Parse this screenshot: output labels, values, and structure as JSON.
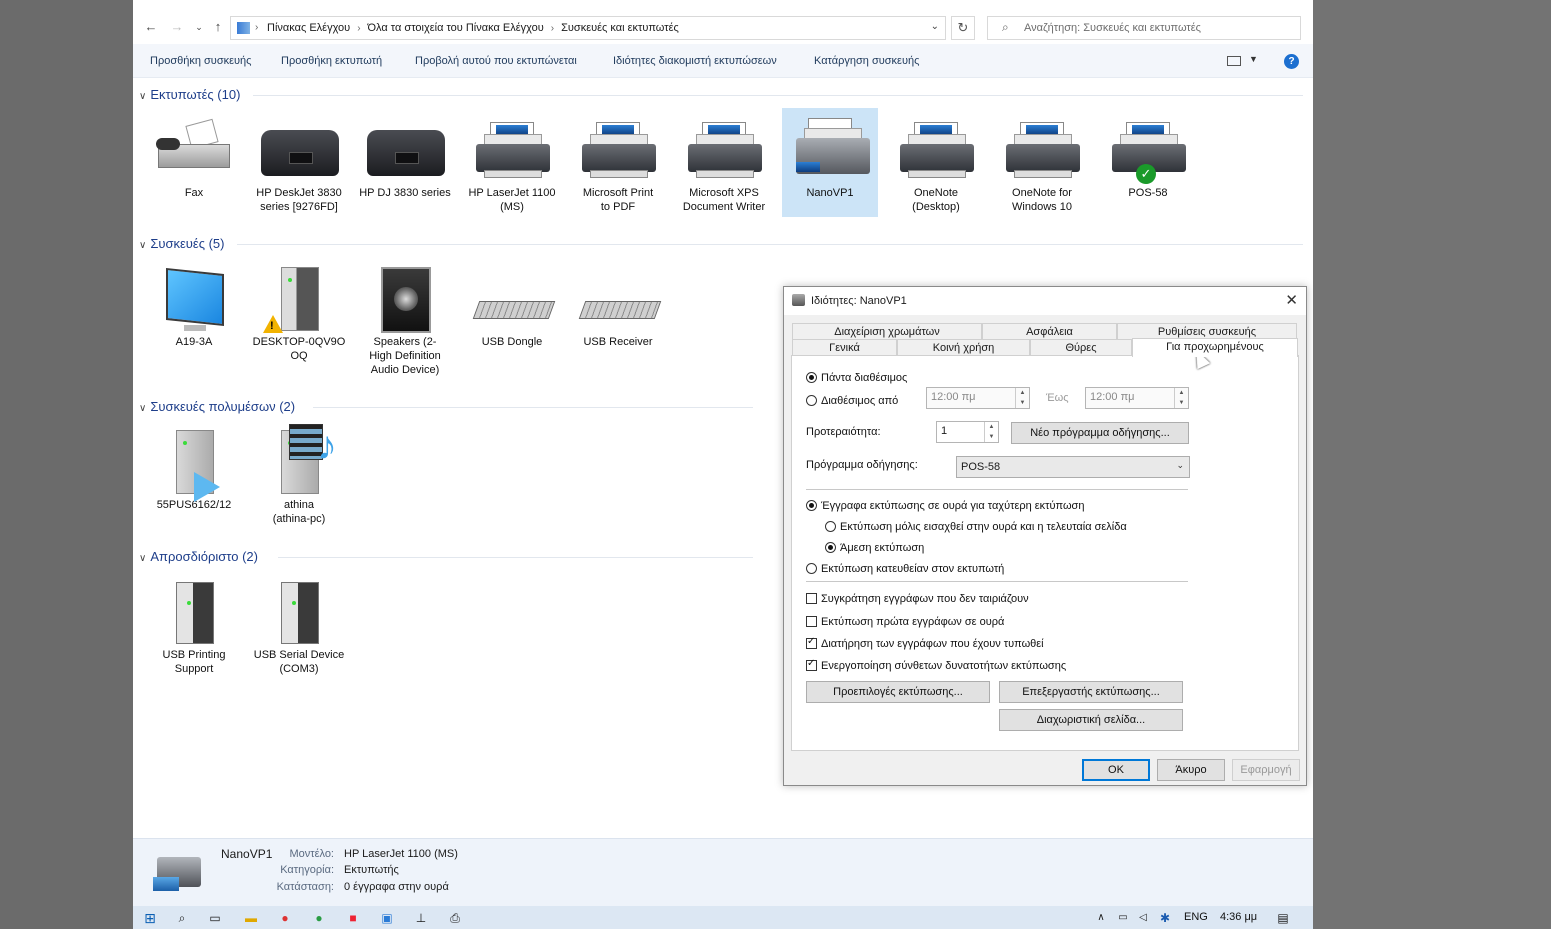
{
  "window_title": "Συσκευές και εκτυπωτές",
  "address": {
    "crumbs": [
      "Πίνακας Ελέγχου",
      "Όλα τα στοιχεία του Πίνακα Ελέγχου",
      "Συσκευές και εκτυπωτές"
    ],
    "search_placeholder": "Αναζήτηση: Συσκευές και εκτυπωτές"
  },
  "toolbar": {
    "add_device": "Προσθήκη συσκευής",
    "add_printer": "Προσθήκη εκτυπωτή",
    "see_printing": "Προβολή αυτού που εκτυπώνεται",
    "print_server": "Ιδιότητες διακομιστή εκτυπώσεων",
    "remove_device": "Κατάργηση συσκευής",
    "help": "?"
  },
  "groups": {
    "printers": {
      "title": "Εκτυπωτές (10)",
      "items": [
        {
          "l1": "Fax",
          "l2": ""
        },
        {
          "l1": "HP DeskJet 3830",
          "l2": "series [9276FD]"
        },
        {
          "l1": "HP DJ 3830 series",
          "l2": ""
        },
        {
          "l1": "HP LaserJet 1100",
          "l2": "(MS)"
        },
        {
          "l1": "Microsoft Print",
          "l2": "to PDF"
        },
        {
          "l1": "Microsoft XPS",
          "l2": "Document Writer"
        },
        {
          "l1": "NanoVP1",
          "l2": ""
        },
        {
          "l1": "OneNote",
          "l2": "(Desktop)"
        },
        {
          "l1": "OneNote for",
          "l2": "Windows 10"
        },
        {
          "l1": "POS-58",
          "l2": ""
        }
      ]
    },
    "devices": {
      "title": "Συσκευές (5)",
      "items": [
        {
          "l1": "A19-3A",
          "l2": "",
          "l3": ""
        },
        {
          "l1": "DESKTOP-0QV9O",
          "l2": "OQ",
          "l3": ""
        },
        {
          "l1": "Speakers (2-",
          "l2": "High Definition",
          "l3": "Audio Device)"
        },
        {
          "l1": "USB Dongle",
          "l2": "",
          "l3": ""
        },
        {
          "l1": "USB Receiver",
          "l2": "",
          "l3": ""
        }
      ]
    },
    "multimedia": {
      "title": "Συσκευές πολυμέσων (2)",
      "items": [
        {
          "l1": "55PUS6162/12",
          "l2": ""
        },
        {
          "l1": "athina",
          "l2": "(athina-pc)"
        }
      ]
    },
    "unspecified": {
      "title": "Απροσδιόριστο (2)",
      "items": [
        {
          "l1": "USB Printing",
          "l2": "Support"
        },
        {
          "l1": "USB Serial Device",
          "l2": "(COM3)"
        }
      ]
    }
  },
  "status": {
    "name": "NanoVP1",
    "model_label": "Μοντέλο:",
    "model": "HP LaserJet 1100 (MS)",
    "category_label": "Κατηγορία:",
    "category": "Εκτυπωτής",
    "state_label": "Κατάσταση:",
    "state": "0 έγγραφα στην ουρά"
  },
  "taskbar": {
    "lang": "ENG",
    "time": "4:36 μμ"
  },
  "dialog": {
    "title": "Ιδιότητες: NanoVP1",
    "tabs_row1": [
      "Διαχείριση χρωμάτων",
      "Ασφάλεια",
      "Ρυθμίσεις συσκευής"
    ],
    "tabs_row2": [
      "Γενικά",
      "Κοινή χρήση",
      "Θύρες",
      "Για προχωρημένους"
    ],
    "always_available": "Πάντα διαθέσιμος",
    "available_from": "Διαθέσιμος από",
    "time_from": "12:00 πμ",
    "to_label": "Έως",
    "time_to": "12:00 πμ",
    "priority_label": "Προτεραιότητα:",
    "priority": "1",
    "new_driver": "Νέο πρόγραμμα οδήγησης...",
    "driver_label": "Πρόγραμμα οδήγησης:",
    "driver": "POS-58",
    "spool": "Έγγραφα εκτύπωσης σε ουρά για ταχύτερη εκτύπωση",
    "start_after_last": "Εκτύπωση μόλις εισαχθεί στην ουρά και η τελευταία σελίδα",
    "start_immediately": "Άμεση εκτύπωση",
    "print_direct": "Εκτύπωση κατευθείαν στον εκτυπωτή",
    "hold_mismatched": "Συγκράτηση εγγράφων που δεν ταιριάζουν",
    "spooled_first": "Εκτύπωση πρώτα εγγράφων σε ουρά",
    "keep_printed": "Διατήρηση των εγγράφων που έχουν τυπωθεί",
    "advanced_features": "Ενεργοποίηση σύνθετων δυνατοτήτων εκτύπωσης",
    "printing_defaults": "Προεπιλογές εκτύπωσης...",
    "print_processor": "Επεξεργαστής εκτύπωσης...",
    "separator_page": "Διαχωριστική σελίδα...",
    "ok": "ΟΚ",
    "cancel": "Άκυρο",
    "apply": "Εφαρμογή"
  }
}
